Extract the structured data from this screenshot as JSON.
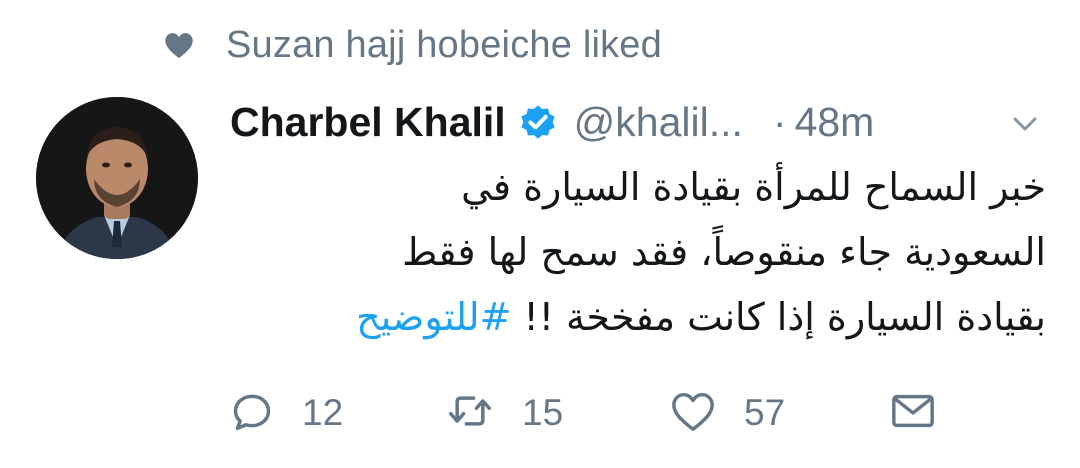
{
  "social_context": {
    "icon": "heart-icon",
    "text": "Suzan hajj hobeiche liked"
  },
  "tweet": {
    "author_name": "Charbel Khalil",
    "verified": true,
    "handle": "@khalil...",
    "separator": "·",
    "time": "48m",
    "text_lines": [
      "خبر السماح للمرأة بقيادة السيارة في",
      "السعودية جاء منقوصاً، فقد سمح لها فقط",
      "بقيادة السيارة إذا كانت مفخخة !!"
    ],
    "hashtag": "#للتوضيح",
    "colors": {
      "hashtag": "#1da1f2",
      "verified_badge": "#1da1f2",
      "secondary_text": "#657786",
      "primary_text": "#14171a"
    }
  },
  "actions": {
    "reply": {
      "icon": "reply-icon",
      "count": "12"
    },
    "retweet": {
      "icon": "retweet-icon",
      "count": "15"
    },
    "like": {
      "icon": "heart-outline-icon",
      "count": "57"
    },
    "message": {
      "icon": "envelope-icon"
    }
  }
}
